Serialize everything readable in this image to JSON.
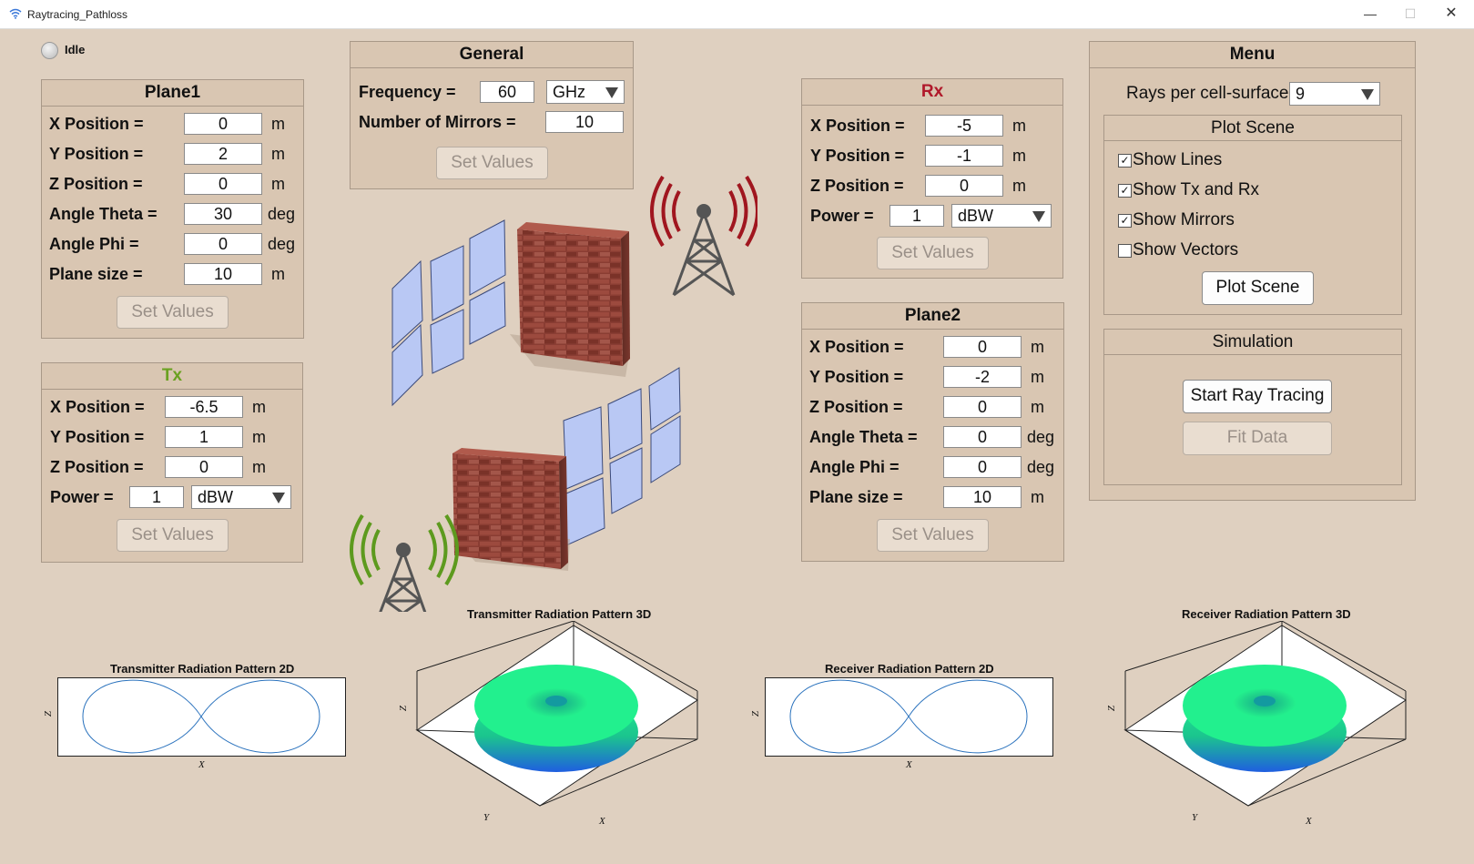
{
  "window": {
    "title": "Raytracing_Pathloss"
  },
  "status": {
    "label": "Idle"
  },
  "plane1": {
    "title": "Plane1",
    "rows": [
      {
        "label": "X Position =",
        "value": "0",
        "unit": "m"
      },
      {
        "label": "Y Position =",
        "value": "2",
        "unit": "m"
      },
      {
        "label": "Z Position =",
        "value": "0",
        "unit": "m"
      },
      {
        "label": "Angle Theta =",
        "value": "30",
        "unit": "deg"
      },
      {
        "label": "Angle Phi =",
        "value": "0",
        "unit": "deg"
      },
      {
        "label": "Plane size =",
        "value": "10",
        "unit": "m"
      }
    ],
    "button": "Set Values"
  },
  "tx": {
    "title": "Tx",
    "title_color": "#6aa121",
    "rows": [
      {
        "label": "X Position =",
        "value": "-6.5",
        "unit": "m"
      },
      {
        "label": "Y Position =",
        "value": "1",
        "unit": "m"
      },
      {
        "label": "Z Position =",
        "value": "0",
        "unit": "m"
      }
    ],
    "power_label": "Power =",
    "power_value": "1",
    "power_unit": "dBW",
    "button": "Set Values"
  },
  "general": {
    "title": "General",
    "frequency_label": "Frequency =",
    "frequency_value": "60",
    "frequency_unit": "GHz",
    "mirrors_label": "Number of Mirrors =",
    "mirrors_value": "10",
    "button": "Set Values"
  },
  "rx": {
    "title": "Rx",
    "title_color": "#b0182a",
    "rows": [
      {
        "label": "X Position =",
        "value": "-5",
        "unit": "m"
      },
      {
        "label": "Y Position =",
        "value": "-1",
        "unit": "m"
      },
      {
        "label": "Z Position =",
        "value": "0",
        "unit": "m"
      }
    ],
    "power_label": "Power =",
    "power_value": "1",
    "power_unit": "dBW",
    "button": "Set Values"
  },
  "plane2": {
    "title": "Plane2",
    "rows": [
      {
        "label": "X Position =",
        "value": "0",
        "unit": "m"
      },
      {
        "label": "Y Position =",
        "value": "-2",
        "unit": "m"
      },
      {
        "label": "Z Position =",
        "value": "0",
        "unit": "m"
      },
      {
        "label": "Angle Theta =",
        "value": "0",
        "unit": "deg"
      },
      {
        "label": "Angle Phi =",
        "value": "0",
        "unit": "deg"
      },
      {
        "label": "Plane size =",
        "value": "10",
        "unit": "m"
      }
    ],
    "button": "Set Values"
  },
  "menu": {
    "title": "Menu",
    "rays_label": "Rays per cell-surface =",
    "rays_value": "9",
    "plot_scene": {
      "title": "Plot Scene",
      "options": [
        {
          "label": "Show Lines",
          "checked": true
        },
        {
          "label": "Show Tx and Rx",
          "checked": true
        },
        {
          "label": "Show Mirrors",
          "checked": true
        },
        {
          "label": "Show Vectors",
          "checked": false
        }
      ],
      "button": "Plot Scene"
    },
    "simulation": {
      "title": "Simulation",
      "start_button": "Start Ray Tracing",
      "fit_button": "Fit Data"
    }
  },
  "plots": {
    "tx2d": {
      "title": "Transmitter Radiation Pattern 2D",
      "xlabel": "X",
      "ylabel": "Z"
    },
    "tx3d": {
      "title": "Transmitter Radiation Pattern 3D",
      "xlabel": "X",
      "ylabel": "Y",
      "zlabel": "Z"
    },
    "rx2d": {
      "title": "Receiver Radiation Pattern 2D",
      "xlabel": "X",
      "ylabel": "Z"
    },
    "rx3d": {
      "title": "Receiver Radiation Pattern 3D",
      "xlabel": "X",
      "ylabel": "Y",
      "zlabel": "Z"
    }
  },
  "colors": {
    "background": "#dfd0c0",
    "panel": "#d9c6b2",
    "tx_antenna": "#5d9a1e",
    "rx_antenna": "#a0161f",
    "mirror": "#b9c8f4",
    "torus_top": "#1ee88a",
    "torus_bottom": "#1f66e0"
  }
}
